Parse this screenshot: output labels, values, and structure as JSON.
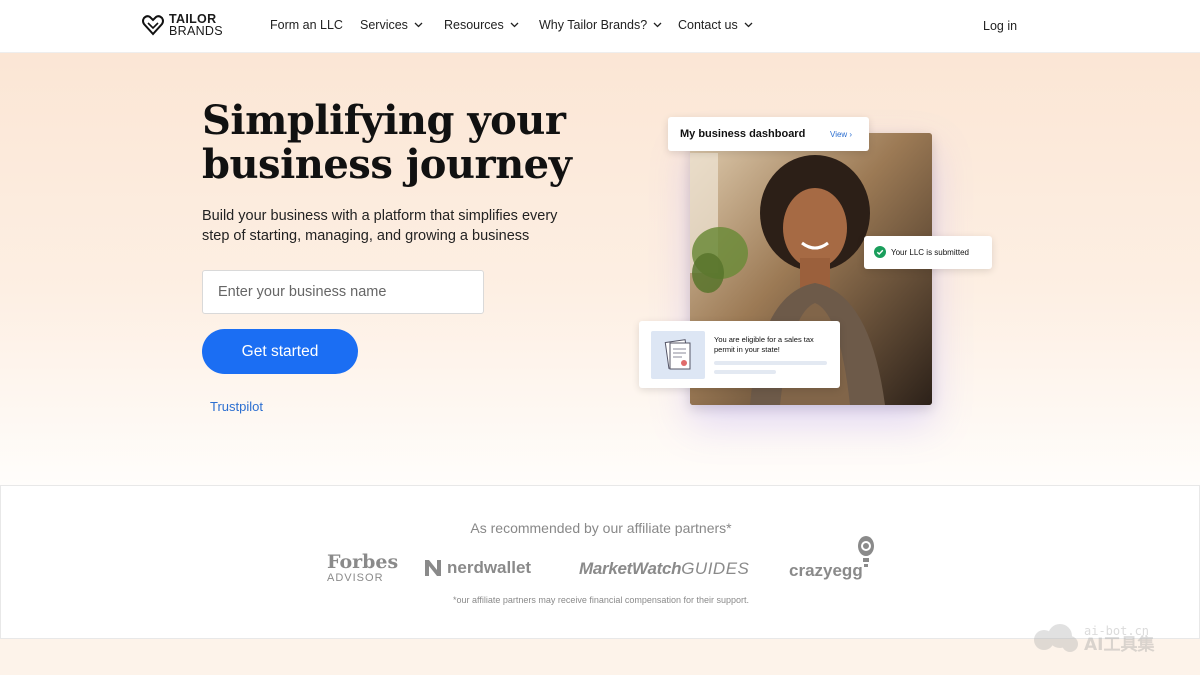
{
  "nav": {
    "brand_line1": "TAILOR",
    "brand_line2": "BRANDS",
    "items": [
      {
        "label": "Form an LLC",
        "has_dropdown": false
      },
      {
        "label": "Services",
        "has_dropdown": true
      },
      {
        "label": "Resources",
        "has_dropdown": true
      },
      {
        "label": "Why Tailor Brands?",
        "has_dropdown": true
      },
      {
        "label": "Contact us",
        "has_dropdown": true
      }
    ],
    "login": "Log in"
  },
  "hero": {
    "title": "Simplifying your business journey",
    "subtitle": "Build your business with a platform that simplifies every step of starting, managing, and growing a business",
    "input_placeholder": "Enter your business name",
    "cta": "Get started",
    "trustpilot": "Trustpilot"
  },
  "visual": {
    "dashboard_title": "My business dashboard",
    "dashboard_view": "View",
    "llc_status": "Your LLC is submitted",
    "permit_text": "You are eligible for a sales tax permit in your state!"
  },
  "partners": {
    "heading": "As recommended by our affiliate partners*",
    "logos": {
      "forbes_line1": "Forbes",
      "forbes_line2": "ADVISOR",
      "nerdwallet": "nerdwallet",
      "marketwatch": "MarketWatch",
      "marketwatch_guides": "GUIDES",
      "crazyegg": "crazyegg"
    },
    "disclaimer": "*our affiliate partners may receive financial compensation for their support."
  },
  "watermark": {
    "line1": "ai-bot.cn",
    "line2": "AI工具集"
  },
  "colors": {
    "primary": "#1b6ef3",
    "link": "#2c6fd1",
    "success": "#1a9e5c",
    "hero_bg": "#fbe6d5"
  }
}
